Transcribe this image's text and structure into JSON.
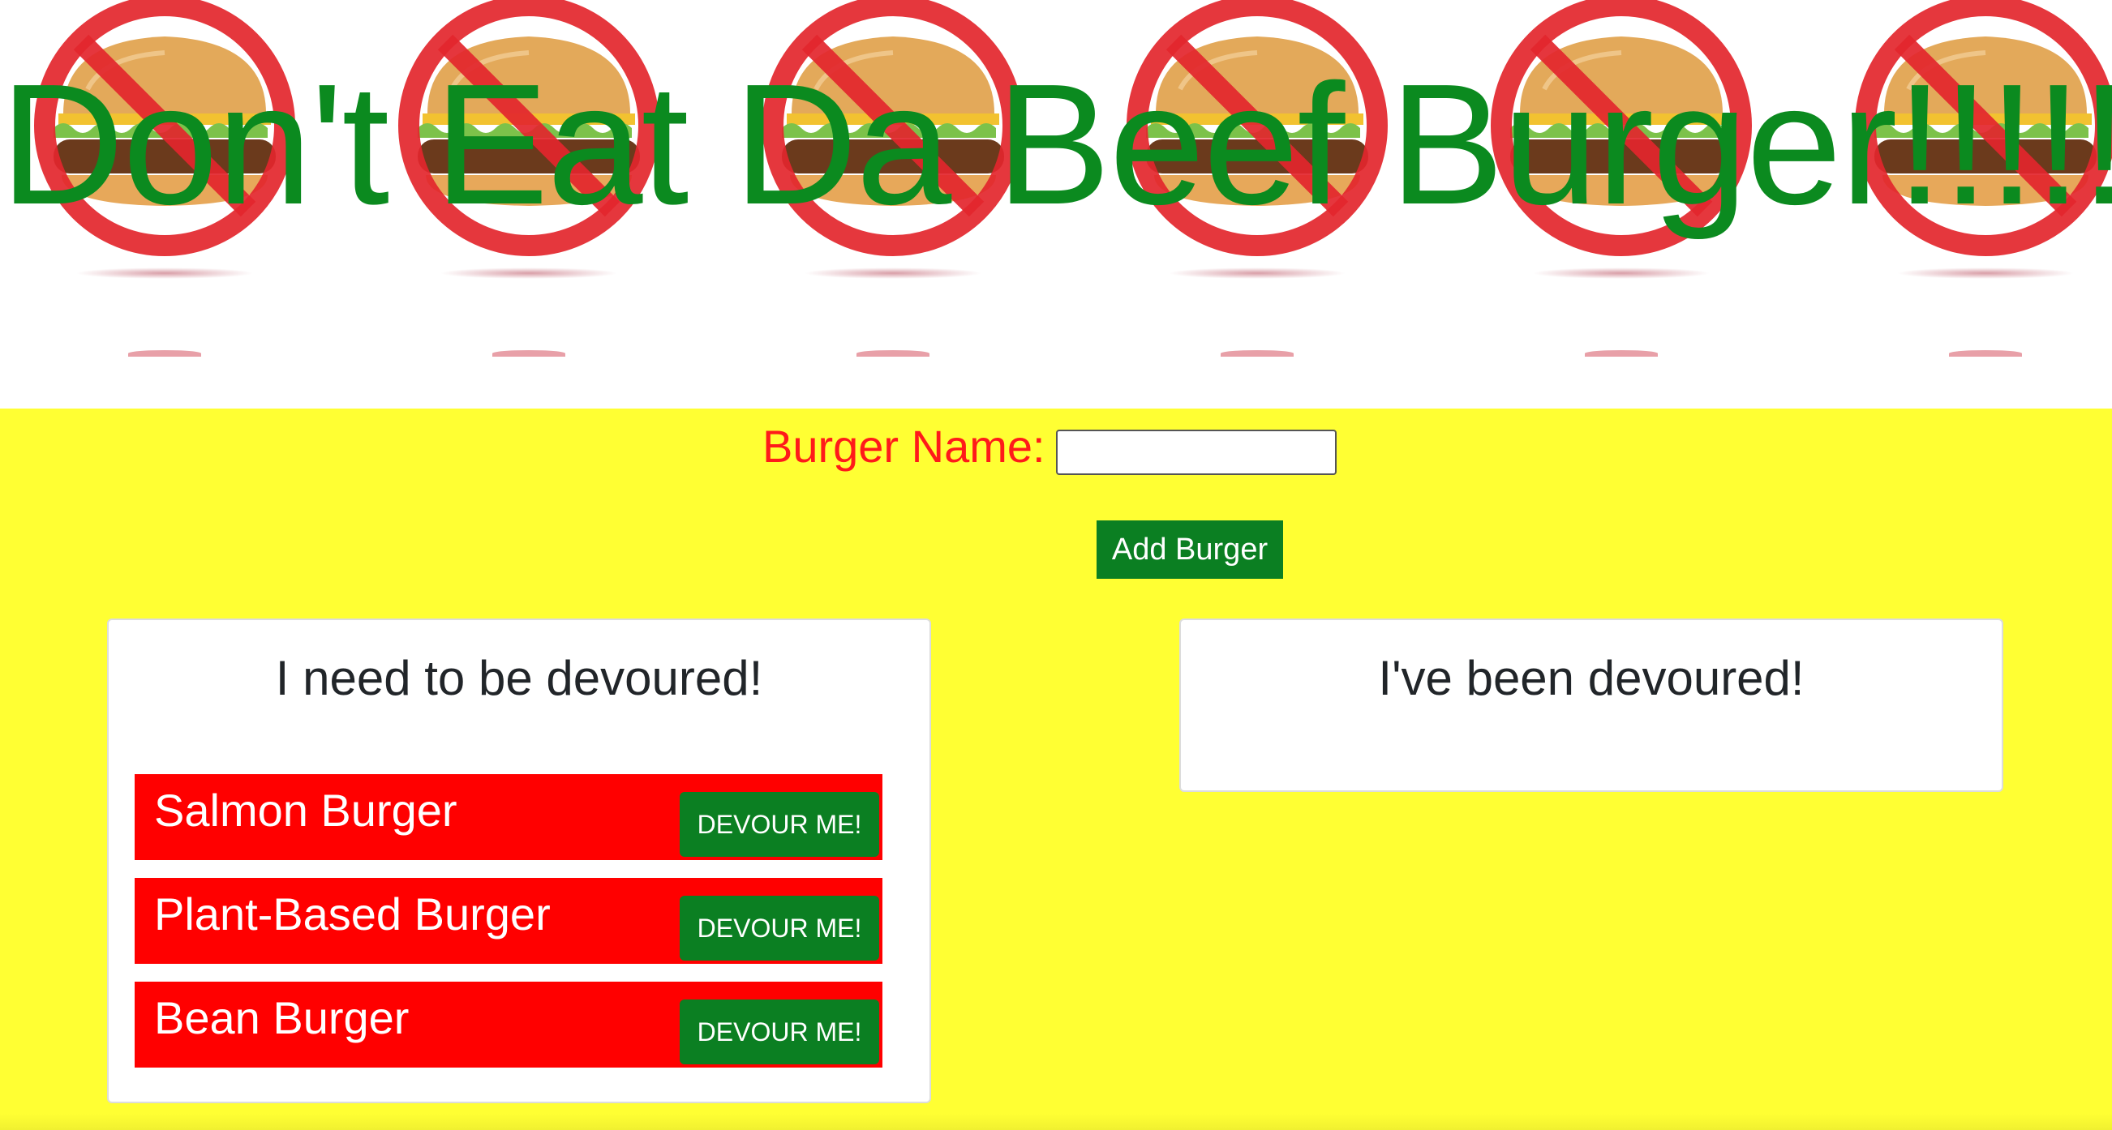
{
  "header": {
    "title": "Don't Eat Da Beef Burger!!!!!!"
  },
  "form": {
    "label": "Burger Name:",
    "input_value": "",
    "input_placeholder": "",
    "add_button_label": "Add Burger"
  },
  "to_devour": {
    "heading": "I need to be devoured!",
    "items": [
      {
        "name": "Salmon Burger",
        "button": "DEVOUR ME!"
      },
      {
        "name": "Plant-Based Burger",
        "button": "DEVOUR ME!"
      },
      {
        "name": "Bean Burger",
        "button": "DEVOUR ME!"
      }
    ]
  },
  "devoured": {
    "heading": "I've been devoured!",
    "items": []
  },
  "colors": {
    "page_background": "#ffff33",
    "title_green": "#0b8a1f",
    "button_green": "#0b7f22",
    "label_red": "#ff1a1a",
    "item_red": "#ff0000"
  },
  "icons": {
    "banner_image": "no-beef-burger-icon"
  }
}
